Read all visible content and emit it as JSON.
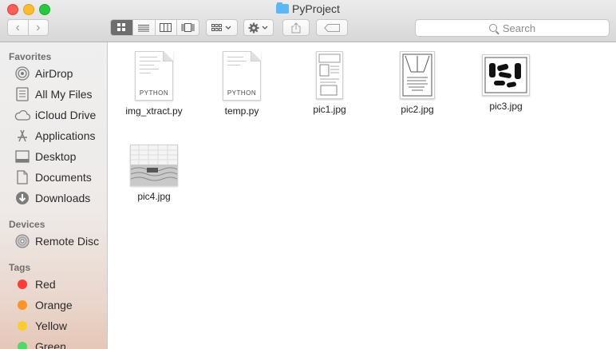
{
  "window": {
    "title": "PyProject"
  },
  "toolbar": {
    "back": "‹",
    "forward": "›",
    "search_placeholder": "Search"
  },
  "sidebar": {
    "favorites_header": "Favorites",
    "favorites": [
      {
        "label": "AirDrop",
        "icon": "airdrop-icon"
      },
      {
        "label": "All My Files",
        "icon": "all-my-files-icon"
      },
      {
        "label": "iCloud Drive",
        "icon": "cloud-icon"
      },
      {
        "label": "Applications",
        "icon": "applications-icon"
      },
      {
        "label": "Desktop",
        "icon": "desktop-icon"
      },
      {
        "label": "Documents",
        "icon": "documents-icon"
      },
      {
        "label": "Downloads",
        "icon": "downloads-icon"
      }
    ],
    "devices_header": "Devices",
    "devices": [
      {
        "label": "Remote Disc",
        "icon": "disc-icon"
      }
    ],
    "tags_header": "Tags",
    "tags": [
      {
        "label": "Red",
        "color": "#fc3d39"
      },
      {
        "label": "Orange",
        "color": "#fd9426"
      },
      {
        "label": "Yellow",
        "color": "#fecb2f"
      },
      {
        "label": "Green",
        "color": "#53d769"
      }
    ]
  },
  "files": [
    {
      "name": "img_xtract.py",
      "kind": "python",
      "badge": "PYTHON"
    },
    {
      "name": "temp.py",
      "kind": "python",
      "badge": "PYTHON"
    },
    {
      "name": "pic1.jpg",
      "kind": "image"
    },
    {
      "name": "pic2.jpg",
      "kind": "image"
    },
    {
      "name": "pic3.jpg",
      "kind": "image"
    },
    {
      "name": "pic4.jpg",
      "kind": "image"
    }
  ]
}
